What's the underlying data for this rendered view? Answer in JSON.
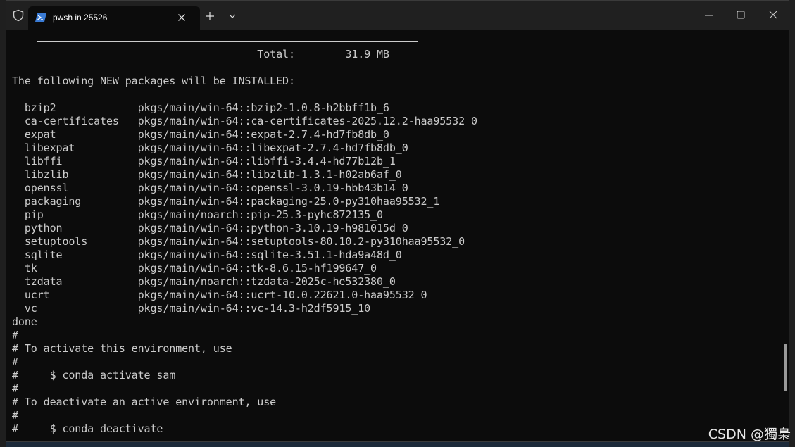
{
  "window": {
    "tab_title": "pwsh in 25526"
  },
  "icons": {
    "shield": "shield-icon",
    "tab": "powershell-icon",
    "close_tab": "close-icon",
    "new_tab": "plus-icon",
    "dropdown": "chevron-down-icon",
    "minimize": "minimize-icon",
    "maximize": "maximize-icon",
    "close_window": "close-icon"
  },
  "terminal": {
    "lines": [
      "                                       Total:        31.9 MB",
      "",
      "The following NEW packages will be INSTALLED:",
      "",
      "  bzip2             pkgs/main/win-64::bzip2-1.0.8-h2bbff1b_6",
      "  ca-certificates   pkgs/main/win-64::ca-certificates-2025.12.2-haa95532_0",
      "  expat             pkgs/main/win-64::expat-2.7.4-hd7fb8db_0",
      "  libexpat          pkgs/main/win-64::libexpat-2.7.4-hd7fb8db_0",
      "  libffi            pkgs/main/win-64::libffi-3.4.4-hd77b12b_1",
      "  libzlib           pkgs/main/win-64::libzlib-1.3.1-h02ab6af_0",
      "  openssl           pkgs/main/win-64::openssl-3.0.19-hbb43b14_0",
      "  packaging         pkgs/main/win-64::packaging-25.0-py310haa95532_1",
      "  pip               pkgs/main/noarch::pip-25.3-pyhc872135_0",
      "  python            pkgs/main/win-64::python-3.10.19-h981015d_0",
      "  setuptools        pkgs/main/win-64::setuptools-80.10.2-py310haa95532_0",
      "  sqlite            pkgs/main/win-64::sqlite-3.51.1-hda9a48d_0",
      "  tk                pkgs/main/win-64::tk-8.6.15-hf199647_0",
      "  tzdata            pkgs/main/noarch::tzdata-2025c-he532380_0",
      "  ucrt              pkgs/main/win-64::ucrt-10.0.22621.0-haa95532_0",
      "  vc                pkgs/main/win-64::vc-14.3-h2df5915_10",
      "done",
      "#",
      "# To activate this environment, use",
      "#",
      "#     $ conda activate sam",
      "#",
      "# To deactivate an active environment, use",
      "#",
      "#     $ conda deactivate"
    ]
  },
  "watermark": "CSDN @獨梟"
}
